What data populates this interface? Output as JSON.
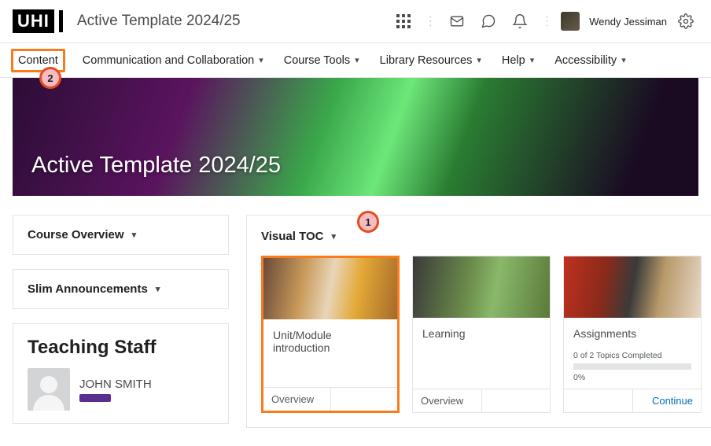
{
  "header": {
    "logo_text": "UHI",
    "course_title": "Active Template 2024/25",
    "username": "Wendy Jessiman"
  },
  "nav": {
    "items": [
      {
        "label": "Content",
        "has_dropdown": false
      },
      {
        "label": "Communication and Collaboration",
        "has_dropdown": true
      },
      {
        "label": "Course Tools",
        "has_dropdown": true
      },
      {
        "label": "Library Resources",
        "has_dropdown": true
      },
      {
        "label": "Help",
        "has_dropdown": true
      },
      {
        "label": "Accessibility",
        "has_dropdown": true
      }
    ]
  },
  "annotations": {
    "badge1": "1",
    "badge2": "2"
  },
  "hero": {
    "title": "Active Template 2024/25"
  },
  "sidebar": {
    "overview_label": "Course Overview",
    "announcements_label": "Slim Announcements",
    "teaching_staff_heading": "Teaching Staff",
    "staff_name": "JOHN SMITH"
  },
  "content": {
    "toc_label": "Visual TOC",
    "cards": [
      {
        "title": "Unit/Module introduction",
        "footer_primary": "Overview",
        "footer_secondary": ""
      },
      {
        "title": "Learning",
        "footer_primary": "Overview",
        "footer_secondary": ""
      },
      {
        "title": "Assignments",
        "progress_text": "0 of 2 Topics Completed",
        "progress_percent": "0%",
        "footer_primary": "",
        "footer_secondary": "Continue"
      }
    ]
  }
}
